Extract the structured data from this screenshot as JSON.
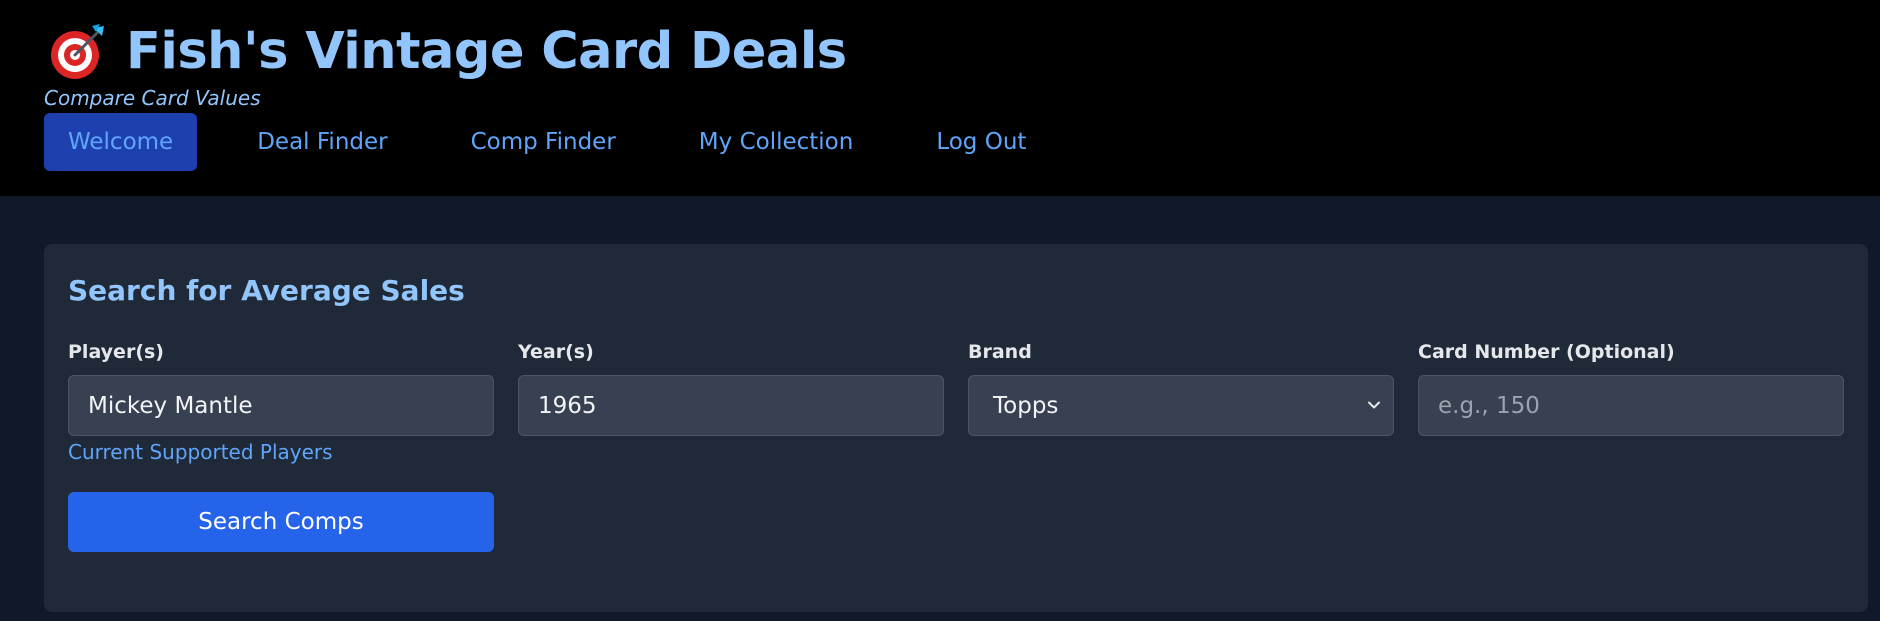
{
  "header": {
    "icon": "target-dart-icon",
    "title": "Fish's Vintage Card Deals",
    "tagline": "Compare Card Values"
  },
  "nav": {
    "items": [
      {
        "label": "Welcome",
        "active": true
      },
      {
        "label": "Deal Finder",
        "active": false
      },
      {
        "label": "Comp Finder",
        "active": false
      },
      {
        "label": "My Collection",
        "active": false
      },
      {
        "label": "Log Out",
        "active": false
      }
    ]
  },
  "search_form": {
    "title": "Search for Average Sales",
    "players": {
      "label": "Player(s)",
      "value": "Mickey Mantle"
    },
    "years": {
      "label": "Year(s)",
      "value": "1965"
    },
    "brand": {
      "label": "Brand",
      "value": "Topps"
    },
    "card_number": {
      "label": "Card Number (Optional)",
      "value": "",
      "placeholder": "e.g., 150"
    },
    "supported_players_link": "Current Supported Players",
    "submit_label": "Search Comps"
  },
  "colors": {
    "header_bg": "#000000",
    "page_bg": "#111827",
    "card_bg": "#1f2937",
    "accent_text": "#93c5fd",
    "link": "#60a5fa",
    "active_nav_bg": "#1e40af",
    "primary_button": "#2563eb"
  }
}
